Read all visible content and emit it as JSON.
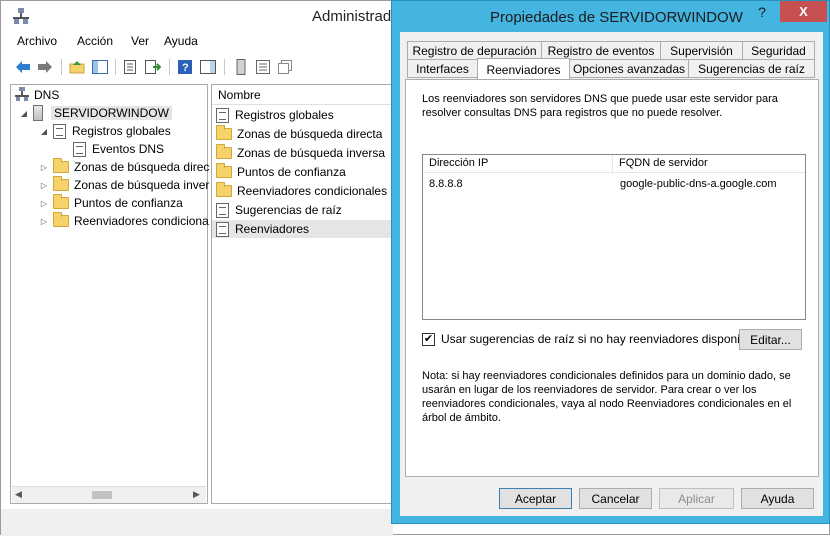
{
  "mmc": {
    "title": "Administrad",
    "menu": [
      "Archivo",
      "Acción",
      "Ver",
      "Ayuda"
    ],
    "tree": {
      "root": "DNS",
      "server": "SERVIDORWINDOW",
      "items": [
        {
          "label": "Registros globales",
          "expanded": true
        },
        {
          "label": "Eventos DNS"
        },
        {
          "label": "Zonas de búsqueda direc"
        },
        {
          "label": "Zonas de búsqueda inver"
        },
        {
          "label": "Puntos de confianza"
        },
        {
          "label": "Reenviadores condiciona"
        }
      ]
    },
    "list": {
      "header": "Nombre",
      "items": [
        "Registros globales",
        "Zonas de búsqueda directa",
        "Zonas de búsqueda inversa",
        "Puntos de confianza",
        "Reenviadores condicionales",
        "Sugerencias de raíz",
        "Reenviadores"
      ]
    }
  },
  "dialog": {
    "title": "Propiedades de SERVIDORWINDOW",
    "help_label": "?",
    "close_label": "X",
    "tabs_row1": [
      "Registro de depuración",
      "Registro de eventos",
      "Supervisión",
      "Seguridad"
    ],
    "tabs_row2": [
      "Interfaces",
      "Reenviadores",
      "Opciones avanzadas",
      "Sugerencias de raíz"
    ],
    "active_tab": "Reenviadores",
    "description": "Los reenviadores son servidores DNS que puede usar este servidor para resolver consultas DNS para registros que no puede resolver.",
    "columns": [
      "Dirección IP",
      "FQDN de servidor"
    ],
    "rows": [
      {
        "ip": "8.8.8.8",
        "fqdn": "google-public-dns-a.google.com"
      }
    ],
    "checkbox_label": "Usar sugerencias de raíz si no hay reenviadores disponibles",
    "checkbox_checked": true,
    "edit_label": "Editar...",
    "note": "Nota: si hay reenviadores condicionales definidos para un dominio dado, se usarán en lugar de los reenviadores de servidor. Para crear o ver los reenviadores condicionales, vaya al nodo Reenviadores condicionales en el árbol de ámbito.",
    "buttons": {
      "ok": "Aceptar",
      "cancel": "Cancelar",
      "apply": "Aplicar",
      "help": "Ayuda"
    }
  },
  "colors": {
    "dialog_frame": "#44b4e0",
    "close_button": "#c75050"
  }
}
